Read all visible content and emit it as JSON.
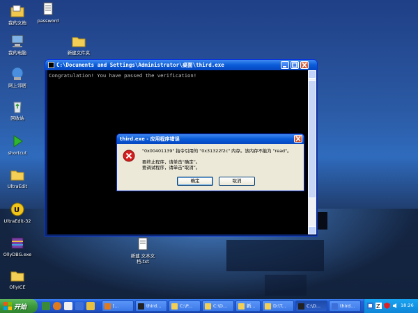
{
  "desktop": {
    "icons": [
      {
        "label": "我的文档"
      },
      {
        "label": "password"
      },
      {
        "label": "我的电脑"
      },
      {
        "label": "新建文件夹"
      },
      {
        "label": "网上邻居"
      },
      {
        "label": "回收站"
      },
      {
        "label": "shortcut"
      },
      {
        "label": "UltraEdit"
      },
      {
        "label": "UltraEdit-32"
      },
      {
        "label": "OllyDBG.exe"
      },
      {
        "label": "OllyICE"
      },
      {
        "label": "新建 文本文档.txt"
      }
    ]
  },
  "console": {
    "title": "C:\\Documents and Settings\\Administrator\\桌面\\third.exe",
    "output": "Congratulation! You have passed the verification!"
  },
  "dialog": {
    "title": "third.exe - 应用程序错误",
    "message": "\"0x00401139\" 指令引用的 \"0x31322f2c\" 内存。该内存不能为 \"read\"。",
    "line1": "要终止程序，请单击“确定”。",
    "line2": "要调试程序，请单击“取消”。",
    "ok_label": "确定",
    "cancel_label": "取消",
    "accent": "#d51f1f"
  },
  "taskbar": {
    "start_label": "开始",
    "tasks": [
      {
        "label": "[..."
      },
      {
        "label": "third..."
      },
      {
        "label": "C:\\P..."
      },
      {
        "label": "C:\\D..."
      },
      {
        "label": "新..."
      },
      {
        "label": "D:\\T..."
      },
      {
        "label": "C:\\D..."
      },
      {
        "label": "third..."
      }
    ],
    "clock": "18:26"
  }
}
